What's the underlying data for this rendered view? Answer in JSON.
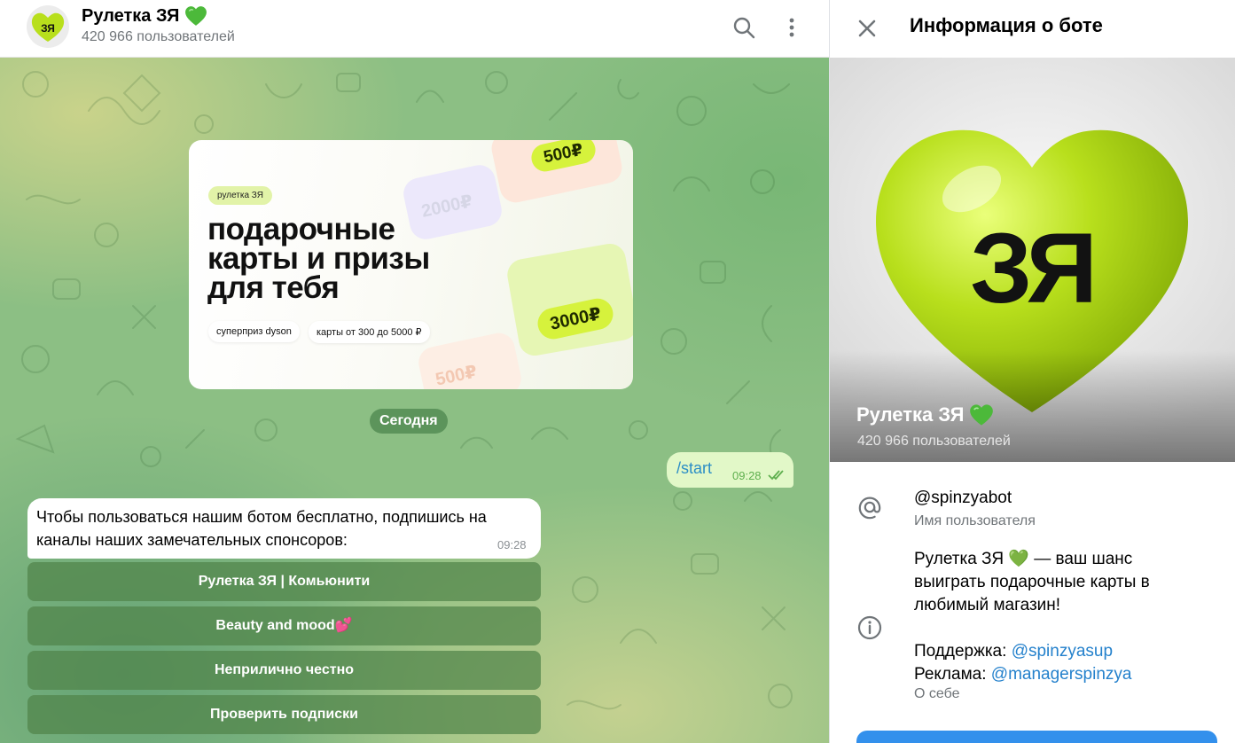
{
  "chat": {
    "title": "Рулетка ЗЯ",
    "subtitle": "420 966 пользователей",
    "avatar_text": "ЗЯ",
    "promo": {
      "tag": "рулетка ЗЯ",
      "headline_lines": [
        "подарочные",
        "карты и призы",
        "для тебя"
      ],
      "chip1": "суперприз dyson",
      "chip2": "карты от 300 до 5000 ₽",
      "price_500_top": "500₽",
      "price_2000": "2000₽",
      "price_3000": "3000₽",
      "price_500_bottom": "500₽"
    },
    "date_label": "Сегодня",
    "outgoing": {
      "text": "/start",
      "time": "09:28"
    },
    "incoming": {
      "text": "Чтобы пользоваться нашим ботом бесплатно, подпишись на каналы наших замечательных спонсоров:",
      "time": "09:28"
    },
    "keyboard": [
      "Рулетка ЗЯ | Комьюнити",
      "Beauty and mood💕",
      "Неприлично честно",
      "Проверить подписки"
    ]
  },
  "info": {
    "title": "Информация о боте",
    "name": "Рулетка ЗЯ",
    "subtitle": "420 966 пользователей",
    "avatar_text": "ЗЯ",
    "username": "@spinzyabot",
    "username_label": "Имя пользователя",
    "about_lines": [
      "Рулетка ЗЯ 💚 — ваш шанс",
      "выиграть подарочные карты в",
      "любимый магазин!"
    ],
    "support_label": "Поддержка:",
    "support_link": "@spinzyasup",
    "ads_label": "Реклама:",
    "ads_link": "@managerspinzya",
    "about_label": "О себе"
  },
  "icons": {
    "search": "search-icon",
    "menu": "more-vertical-icon",
    "close": "close-icon",
    "at": "at-sign-icon",
    "info": "info-icon",
    "heart": "green-heart-emoji",
    "double_check": "double-check-icon"
  },
  "colors": {
    "accent": "#3390ec",
    "link": "#2481cc",
    "brand_lime": "#b8df1c",
    "outgoing_bubble": "#e2f8c8",
    "keyboard_button": "#50844a"
  }
}
